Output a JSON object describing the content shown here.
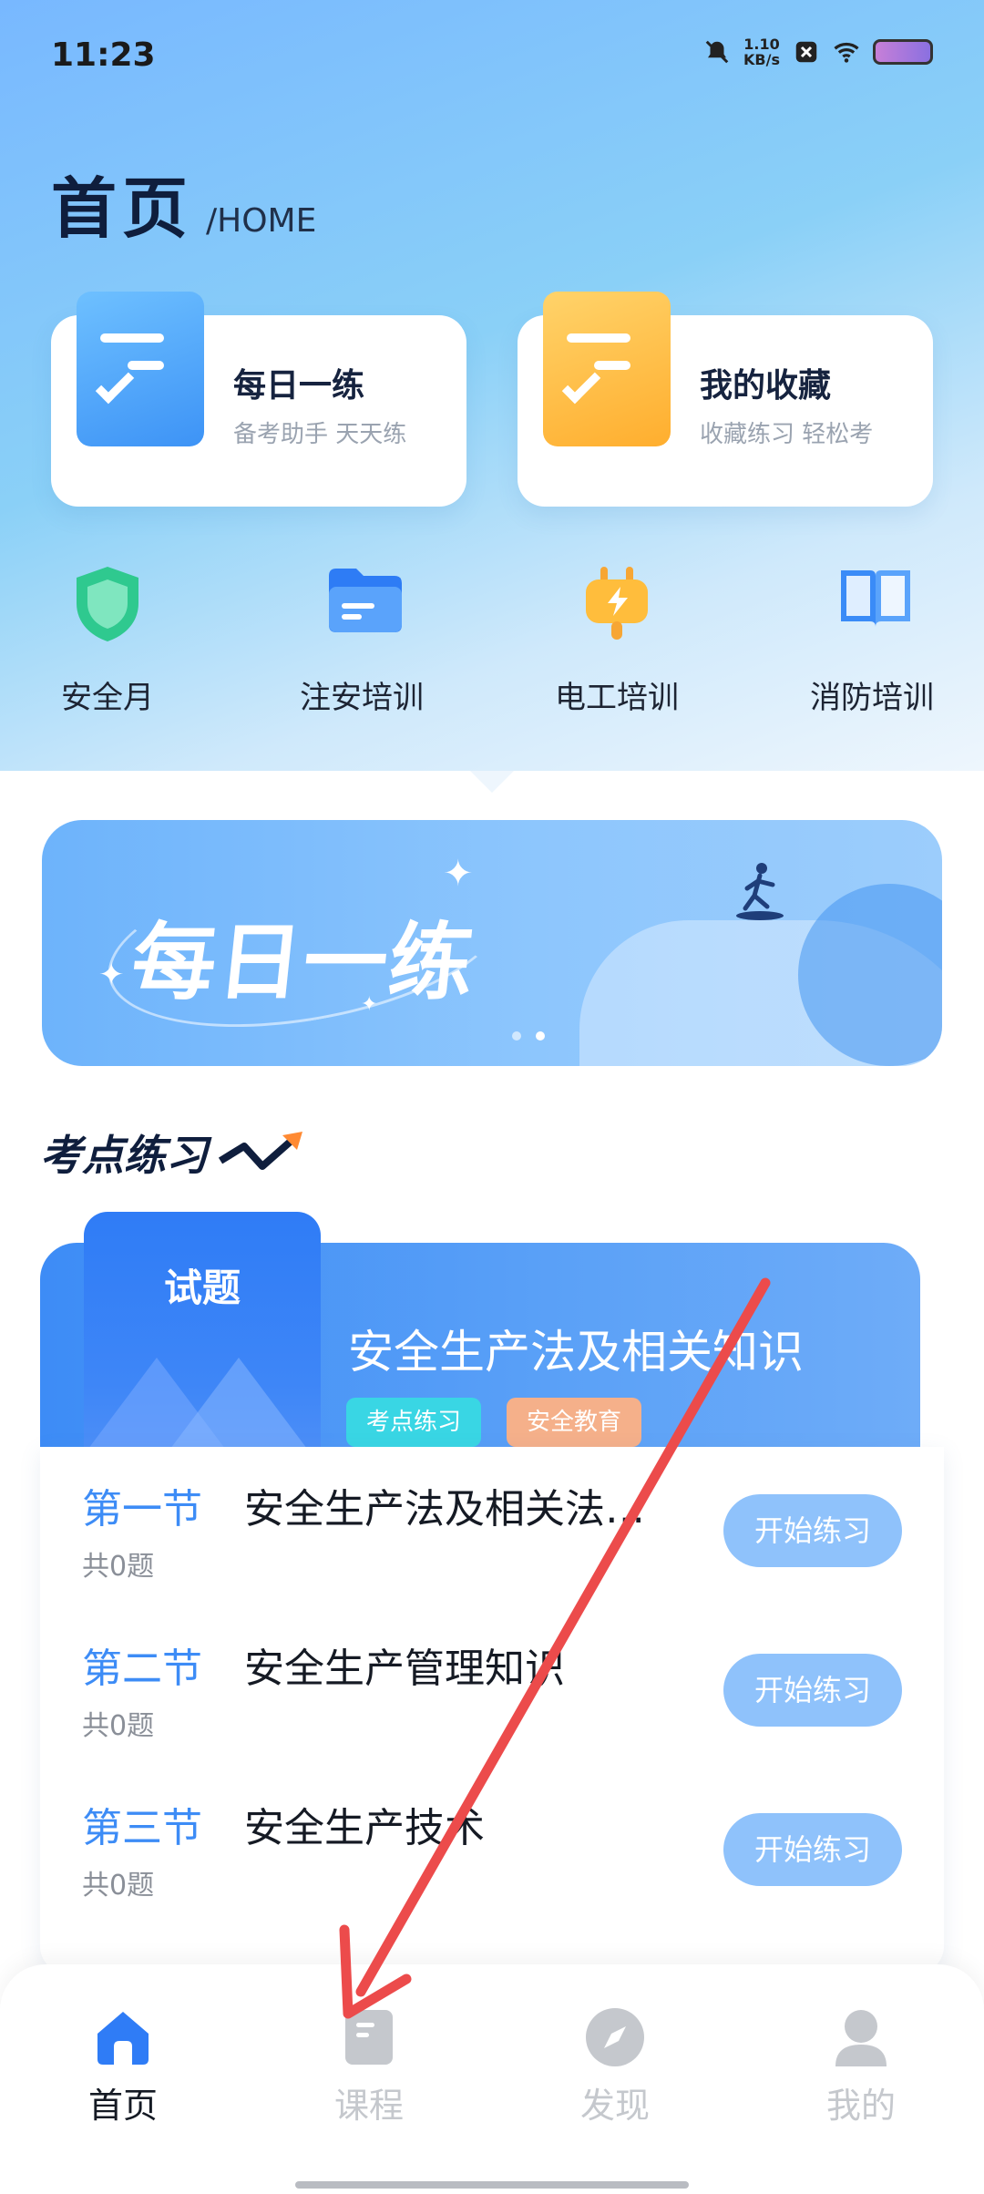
{
  "status_bar": {
    "time": "11:23",
    "net_speed_value": "1.10",
    "net_speed_unit": "KB/s"
  },
  "header": {
    "title": "首页",
    "subtitle": "/HOME"
  },
  "cards": [
    {
      "title": "每日一练",
      "subtitle": "备考助手 天天练",
      "icon": "daily-practice-doc-icon",
      "color": "#4ba8fb"
    },
    {
      "title": "我的收藏",
      "subtitle": "收藏练习 轻松考",
      "icon": "favorites-doc-icon",
      "color": "#ffc04d"
    }
  ],
  "quick_links": [
    {
      "label": "安全月",
      "icon": "shield-icon"
    },
    {
      "label": "注安培训",
      "icon": "folder-icon"
    },
    {
      "label": "电工培训",
      "icon": "plug-icon"
    },
    {
      "label": "消防培训",
      "icon": "book-icon"
    }
  ],
  "banner": {
    "title": "每日一练",
    "dots_total": 2,
    "active_dot": 2
  },
  "section": {
    "title": "考点练习"
  },
  "exam": {
    "tab_label": "试题",
    "title": "安全生产法及相关知识",
    "tags": [
      "考点练习",
      "安全教育"
    ],
    "chapters": [
      {
        "section": "第一节",
        "name": "安全生产法及相关法…",
        "count": "共0题",
        "button": "开始练习"
      },
      {
        "section": "第二节",
        "name": "安全生产管理知识",
        "count": "共0题",
        "button": "开始练习"
      },
      {
        "section": "第三节",
        "name": "安全生产技术",
        "count": "共0题",
        "button": "开始练习"
      }
    ]
  },
  "tab_bar": [
    {
      "label": "首页",
      "icon": "home-icon",
      "active": true
    },
    {
      "label": "课程",
      "icon": "course-icon",
      "active": false
    },
    {
      "label": "发现",
      "icon": "compass-icon",
      "active": false
    },
    {
      "label": "我的",
      "icon": "profile-icon",
      "active": false
    }
  ],
  "colors": {
    "primary": "#3d8cf6",
    "button": "#8fc2fb",
    "annotation_arrow": "#ec4b4b"
  }
}
